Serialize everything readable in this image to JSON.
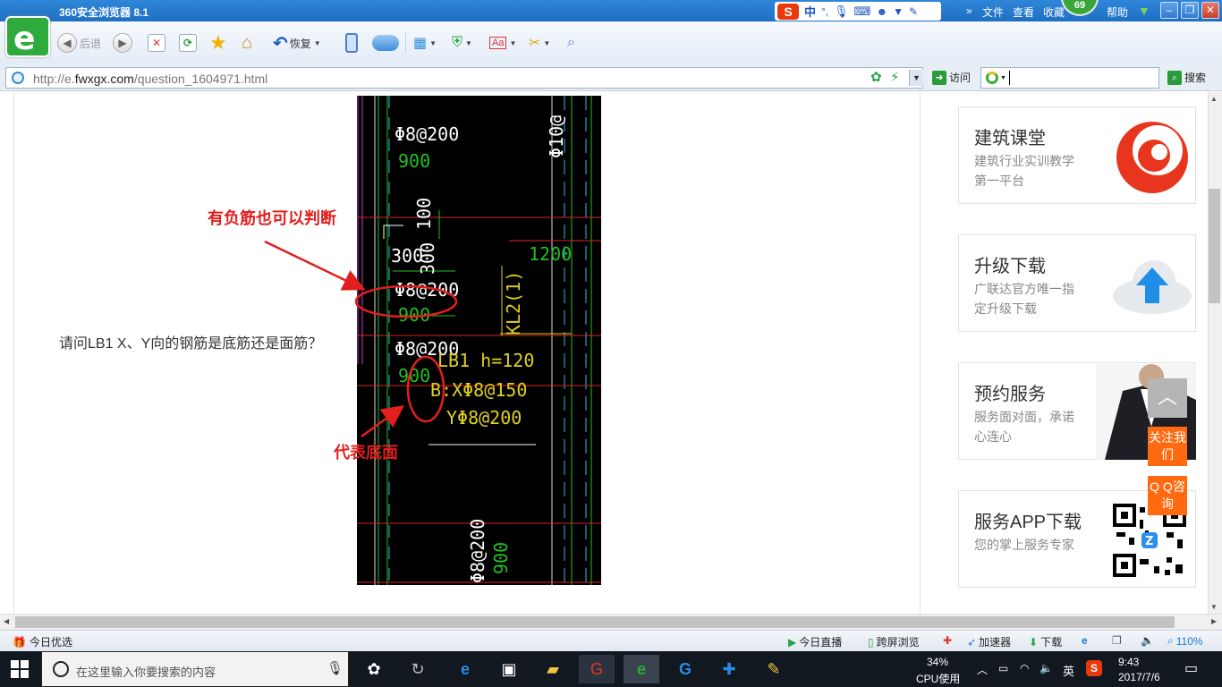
{
  "titlebar": {
    "app_title": "360安全浏览器 8.1",
    "menu": [
      "文件",
      "查看",
      "收藏",
      "帮助"
    ],
    "badge_count": "69",
    "ime": [
      "中",
      "°,"
    ]
  },
  "toolbar": {
    "back_label": "后退",
    "restore_label": "恢复"
  },
  "address": {
    "url_prefix": "http://e.",
    "url_domain": "fwxgx.com",
    "url_path": "/question_1604971.html",
    "visit_label": "访问",
    "search_label": "搜索",
    "search_value": ""
  },
  "content": {
    "question": "请问LB1  X、Y向的钢筋是底筋还是面筋？",
    "annotation_top": "有负筋也可以判断",
    "annotation_bottom": "代表底面",
    "drawing_labels": [
      "Φ10@",
      "Φ8@200",
      "900",
      "100",
      "300",
      "300",
      "1200",
      "Φ8@200",
      "900",
      "KL2(1)",
      "Φ8@200",
      "900",
      "LB1 h=120",
      "B:XΦ8@150",
      "YΦ8@200",
      "Φ8@200",
      "900"
    ]
  },
  "sidebar": {
    "cards": [
      {
        "title": "建筑课堂",
        "desc": "建筑行业实训教学第一平台",
        "icon": "fwxgx-logo-icon"
      },
      {
        "title": "升级下载",
        "desc": "广联达官方唯一指定升级下载",
        "icon": "cloud-upload-icon"
      },
      {
        "title": "预约服务",
        "desc": "服务面对面，承诺心连心",
        "icon": "businessman-photo"
      },
      {
        "title": "服务APP下载",
        "desc": "您的掌上服务专家",
        "icon": "qr-code-icon"
      }
    ],
    "float_buttons": {
      "top": "",
      "follow": "关注我们",
      "qq": "Q Q咨询"
    }
  },
  "statusbar": {
    "left": "今日优选",
    "items": [
      "今日直播",
      "跨屏浏览",
      "加速器",
      "下载"
    ],
    "zoom": "110%"
  },
  "taskbar": {
    "search_placeholder": "在这里输入你要搜索的内容",
    "cpu_percent": "34%",
    "cpu_label": "CPU使用",
    "ime": "英",
    "time": "9:43",
    "date": "2017/7/6"
  }
}
